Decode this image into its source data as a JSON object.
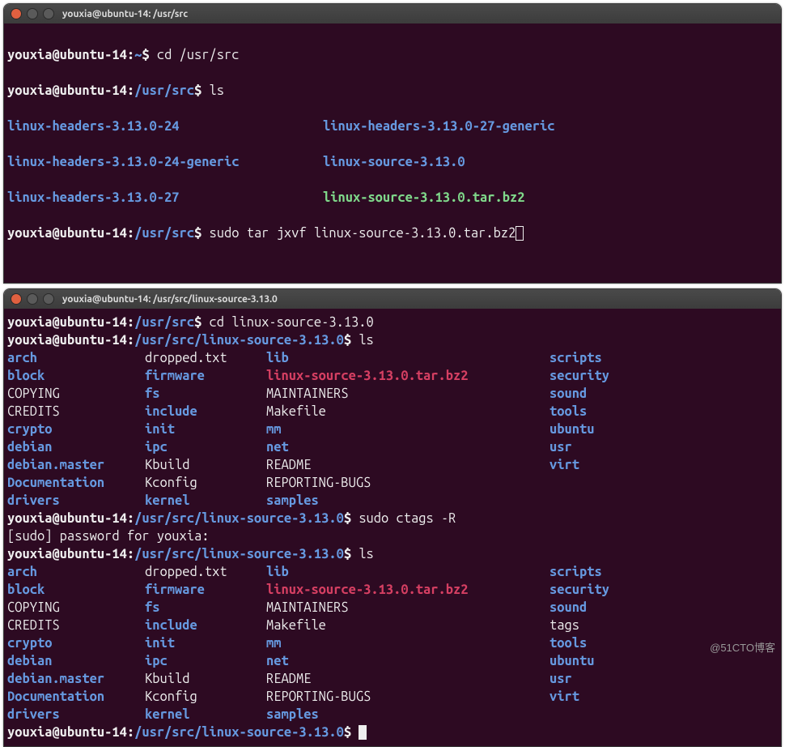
{
  "watermark": "@51CTO博客",
  "win1": {
    "title": "youxia@ubuntu-14: /usr/src",
    "lines": {
      "p1user": "youxia@ubuntu-14",
      "p1path": "~",
      "p1dollar": "$ ",
      "cmd1": "cd /usr/src",
      "p2user": "youxia@ubuntu-14",
      "p2path": "/usr/src",
      "cmd2": "ls",
      "ls1a": "linux-headers-3.13.0-24",
      "ls1b": "linux-headers-3.13.0-27-generic",
      "ls2a": "linux-headers-3.13.0-24-generic",
      "ls2b": "linux-source-3.13.0",
      "ls3a": "linux-headers-3.13.0-27",
      "ls3b": "linux-source-3.13.0.tar.bz2",
      "cmd3": "sudo tar jxvf linux-source-3.13.0.tar.bz2"
    }
  },
  "win2": {
    "title": "youxia@ubuntu-14: /usr/src/linux-source-3.13.0",
    "p_user": "youxia@ubuntu-14",
    "p_path_src": "/usr/src",
    "p_path_full": "/usr/src/linux-source-3.13.0",
    "cmd_cd": "cd linux-source-3.13.0",
    "cmd_ls": "ls",
    "cmd_ctags": "sudo ctags -R",
    "sudo_prompt": "[sudo] password for youxia: ",
    "ls1": [
      {
        "c1": "arch",
        "t1": "dir",
        "c2": "dropped.txt",
        "t2": "",
        "c3": "lib",
        "t3": "dir",
        "c4": "scripts",
        "t4": "dir"
      },
      {
        "c1": "block",
        "t1": "dir",
        "c2": "firmware",
        "t2": "dir",
        "c3": "linux-source-3.13.0.tar.bz2",
        "t3": "arc",
        "c4": "security",
        "t4": "dir"
      },
      {
        "c1": "COPYING",
        "t1": "",
        "c2": "fs",
        "t2": "dir",
        "c3": "MAINTAINERS",
        "t3": "",
        "c4": "sound",
        "t4": "dir"
      },
      {
        "c1": "CREDITS",
        "t1": "",
        "c2": "include",
        "t2": "dir",
        "c3": "Makefile",
        "t3": "",
        "c4": "tools",
        "t4": "dir"
      },
      {
        "c1": "crypto",
        "t1": "dir",
        "c2": "init",
        "t2": "dir",
        "c3": "mm",
        "t3": "dir",
        "c4": "ubuntu",
        "t4": "dir"
      },
      {
        "c1": "debian",
        "t1": "dir",
        "c2": "ipc",
        "t2": "dir",
        "c3": "net",
        "t3": "dir",
        "c4": "usr",
        "t4": "dir"
      },
      {
        "c1": "debian.master",
        "t1": "dir",
        "c2": "Kbuild",
        "t2": "",
        "c3": "README",
        "t3": "",
        "c4": "virt",
        "t4": "dir"
      },
      {
        "c1": "Documentation",
        "t1": "dir",
        "c2": "Kconfig",
        "t2": "",
        "c3": "REPORTING-BUGS",
        "t3": "",
        "c4": "",
        "t4": ""
      },
      {
        "c1": "drivers",
        "t1": "dir",
        "c2": "kernel",
        "t2": "dir",
        "c3": "samples",
        "t3": "dir",
        "c4": "",
        "t4": ""
      }
    ],
    "ls2": [
      {
        "c1": "arch",
        "t1": "dir",
        "c2": "dropped.txt",
        "t2": "",
        "c3": "lib",
        "t3": "dir",
        "c4": "scripts",
        "t4": "dir"
      },
      {
        "c1": "block",
        "t1": "dir",
        "c2": "firmware",
        "t2": "dir",
        "c3": "linux-source-3.13.0.tar.bz2",
        "t3": "arc",
        "c4": "security",
        "t4": "dir"
      },
      {
        "c1": "COPYING",
        "t1": "",
        "c2": "fs",
        "t2": "dir",
        "c3": "MAINTAINERS",
        "t3": "",
        "c4": "sound",
        "t4": "dir"
      },
      {
        "c1": "CREDITS",
        "t1": "",
        "c2": "include",
        "t2": "dir",
        "c3": "Makefile",
        "t3": "",
        "c4": "tags",
        "t4": ""
      },
      {
        "c1": "crypto",
        "t1": "dir",
        "c2": "init",
        "t2": "dir",
        "c3": "mm",
        "t3": "dir",
        "c4": "tools",
        "t4": "dir"
      },
      {
        "c1": "debian",
        "t1": "dir",
        "c2": "ipc",
        "t2": "dir",
        "c3": "net",
        "t3": "dir",
        "c4": "ubuntu",
        "t4": "dir"
      },
      {
        "c1": "debian.master",
        "t1": "dir",
        "c2": "Kbuild",
        "t2": "",
        "c3": "README",
        "t3": "",
        "c4": "usr",
        "t4": "dir"
      },
      {
        "c1": "Documentation",
        "t1": "dir",
        "c2": "Kconfig",
        "t2": "",
        "c3": "REPORTING-BUGS",
        "t3": "",
        "c4": "virt",
        "t4": "dir"
      },
      {
        "c1": "drivers",
        "t1": "dir",
        "c2": "kernel",
        "t2": "dir",
        "c3": "samples",
        "t3": "dir",
        "c4": "",
        "t4": ""
      }
    ]
  }
}
